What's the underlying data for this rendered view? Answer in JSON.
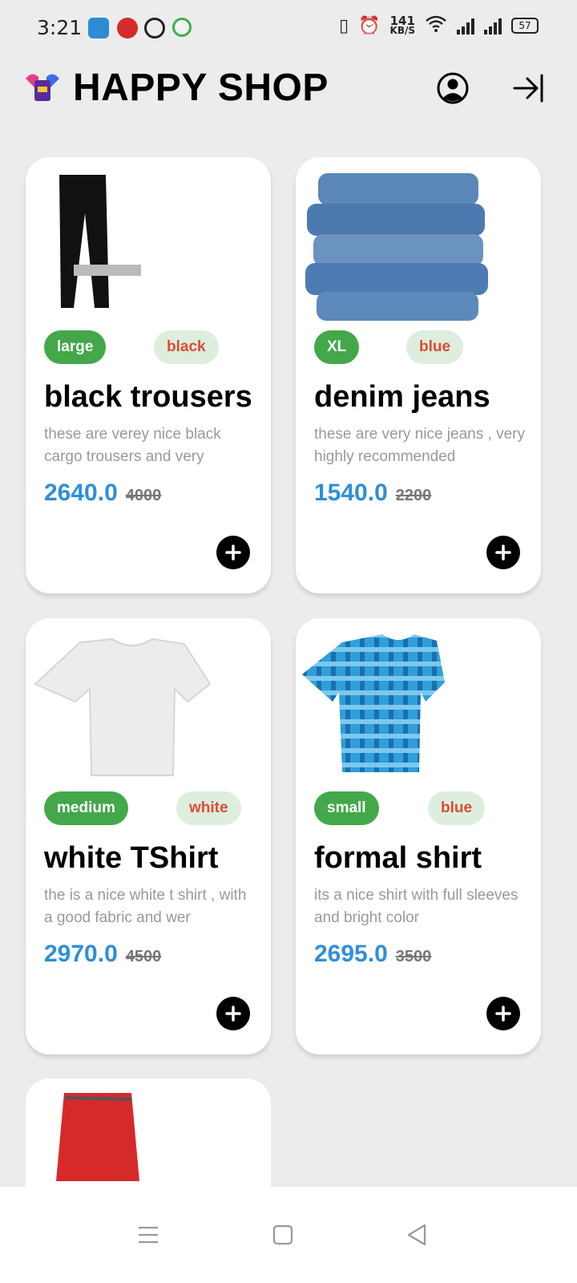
{
  "status_bar": {
    "time": "3:21",
    "net_speed_value": "141",
    "net_speed_unit": "KB/S",
    "battery": "57"
  },
  "app_bar": {
    "title": "HAPPY SHOP"
  },
  "products": [
    {
      "size": "large",
      "color": "black",
      "title": "black trousers",
      "description": "these are verey nice black cargo trousers and very",
      "price": "2640.0",
      "old_price": "4000"
    },
    {
      "size": "XL",
      "color": "blue",
      "title": "denim jeans",
      "description": "these are very nice jeans , very highly recommended",
      "price": "1540.0",
      "old_price": "2200"
    },
    {
      "size": "medium",
      "color": "white",
      "title": "white TShirt",
      "description": "the is a nice white t shirt , with a good fabric and wer",
      "price": "2970.0",
      "old_price": "4500"
    },
    {
      "size": "small",
      "color": "blue",
      "title": "formal shirt",
      "description": "its a nice shirt with full sleeves and bright color",
      "price": "2695.0",
      "old_price": "3500"
    }
  ],
  "icons": {
    "profile": "account-circle-icon",
    "logout": "logout-icon",
    "add": "plus-circle-icon",
    "nav_menu": "menu-icon",
    "nav_home": "home-square-icon",
    "nav_back": "back-triangle-icon"
  },
  "colors": {
    "size_chip": "#43a84a",
    "color_chip_bg": "#ddeede",
    "color_chip_text": "#e04a35",
    "price": "#2f8fd8"
  }
}
